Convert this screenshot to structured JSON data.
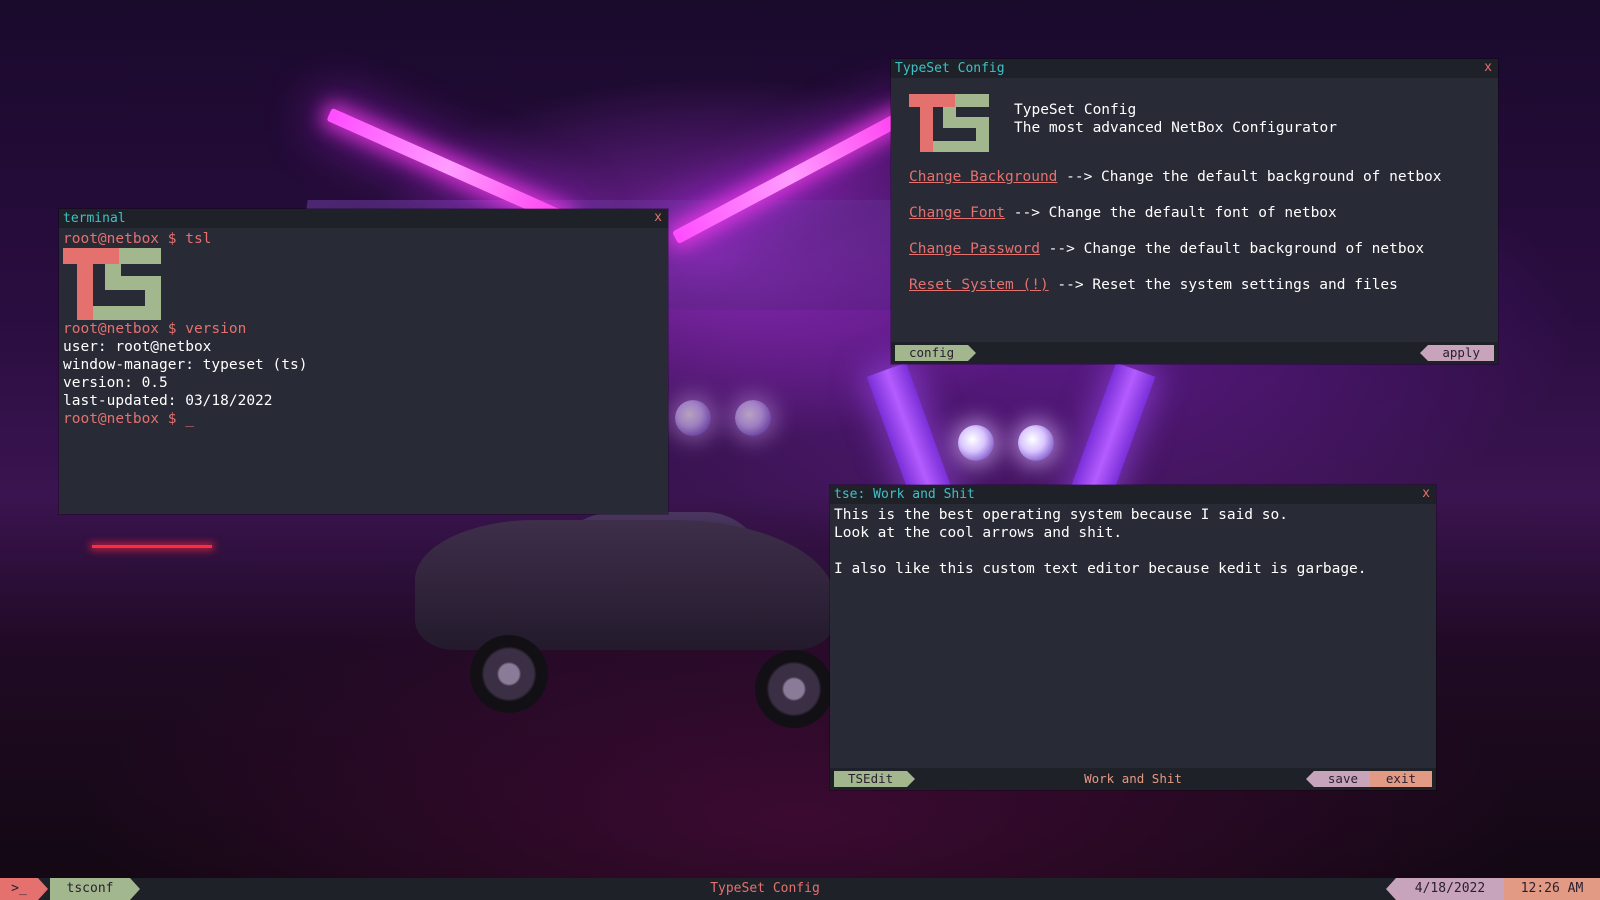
{
  "terminal": {
    "title": "terminal",
    "close": "x",
    "lines": [
      {
        "prompt": "root@netbox $ tsl"
      },
      {
        "prompt": "root@netbox $ version"
      },
      {
        "text": "user: root@netbox"
      },
      {
        "text": "window-manager: typeset (ts)"
      },
      {
        "text": "version: 0.5"
      },
      {
        "text": "last-updated: 03/18/2022"
      },
      {
        "prompt": "root@netbox $ _"
      }
    ]
  },
  "config": {
    "title": "TypeSet Config",
    "close": "x",
    "heading": "TypeSet Config",
    "subheading": "The most advanced NetBox Configurator",
    "items": [
      {
        "link": "Change Background",
        "desc": " --> Change the default background of netbox"
      },
      {
        "link": "Change Font",
        "desc": " --> Change the default font of netbox"
      },
      {
        "link": "Change Password",
        "desc": " --> Change the default background of netbox"
      },
      {
        "link": "Reset System (!)",
        "desc": " --> Reset the system settings and files"
      }
    ],
    "left_tab": "config",
    "apply": "apply"
  },
  "editor": {
    "title": "tse: Work and Shit",
    "close": "x",
    "lines": [
      "This is the best operating system because I said so.",
      "Look at the cool arrows and shit.",
      "",
      "I also like this custom text editor because kedit is garbage."
    ],
    "app_tab": "TSEdit",
    "filename": "Work and Shit",
    "save": "save",
    "exit": "exit"
  },
  "taskbar": {
    "shell": ">_",
    "app": "tsconf",
    "active_window": "TypeSet Config",
    "date": "4/18/2022",
    "time": "12:26 AM"
  },
  "colors": {
    "accent_cyan": "#3ec1c6",
    "accent_red": "#e5716f",
    "accent_green": "#a3b78f",
    "accent_pink": "#c8a4bc",
    "window_bg": "#282a35"
  }
}
